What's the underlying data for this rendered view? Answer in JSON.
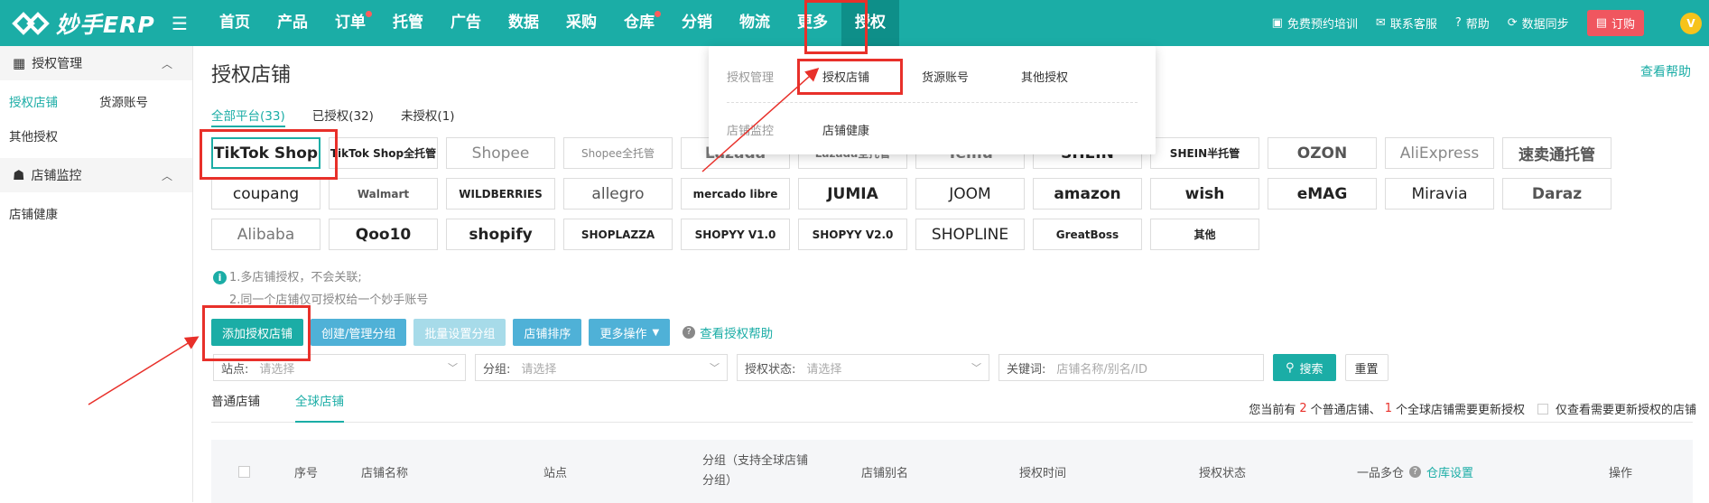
{
  "topbar": {
    "logo_text": "妙手ERP",
    "nav": [
      "首页",
      "产品",
      "订单",
      "托管",
      "广告",
      "数据",
      "采购",
      "仓库",
      "分销",
      "物流",
      "更多",
      "授权"
    ],
    "nav_dots": [
      "订单",
      "仓库"
    ],
    "active_nav": "授权",
    "tools": [
      "免费预约培训",
      "联系客服",
      "帮助",
      "数据同步"
    ],
    "order_label": "订购",
    "avatar_letter": "V"
  },
  "sidebar": {
    "groups": [
      {
        "label": "授权管理",
        "links": [
          "授权店铺",
          "货源账号",
          "其他授权"
        ]
      },
      {
        "label": "店铺监控",
        "links": [
          "店铺健康"
        ]
      }
    ]
  },
  "page": {
    "title": "授权店铺",
    "help_link": "查看帮助",
    "platform_tabs": [
      "全部平台(33)",
      "已授权(32)",
      "未授权(1)"
    ],
    "platforms": [
      "TikTok Shop",
      "TikTok Shop全托管",
      "Shopee",
      "Shopee全托管",
      "Lazada",
      "Lazada全托管",
      "Temu",
      "SHEIN",
      "SHEIN半托管",
      "OZON",
      "AliExpress",
      "速卖通托管",
      "coupang",
      "Walmart",
      "WILDBERRIES",
      "allegro",
      "mercado libre",
      "JUMIA",
      "JOOM",
      "amazon",
      "wish",
      "eMAG",
      "Miravia",
      "Daraz",
      "Alibaba",
      "Qoo10",
      "shopify",
      "SHOPLAZZA",
      "SHOPYY V1.0",
      "SHOPYY V2.0",
      "SHOPLINE",
      "GreatBoss",
      "其他"
    ],
    "notes": [
      "1.多店铺授权，不会关联;",
      "2.同一个店铺仅可授权给一个妙手账号"
    ],
    "buttons": [
      "添加授权店铺",
      "创建/管理分组",
      "批量设置分组",
      "店铺排序",
      "更多操作"
    ],
    "auth_help": "查看授权帮助",
    "filters": [
      {
        "label": "站点:",
        "placeholder": "请选择"
      },
      {
        "label": "分组:",
        "placeholder": "请选择"
      },
      {
        "label": "授权状态:",
        "placeholder": "请选择"
      },
      {
        "label": "关键词:",
        "placeholder": "店铺名称/别名/ID"
      }
    ],
    "search_label": "搜索",
    "reset_label": "重置",
    "store_tabs": [
      "普通店铺",
      "全球店铺"
    ],
    "notice": {
      "pre": "您当前有",
      "n1": "2",
      "mid": "个普通店铺、",
      "n2": "1",
      "post": "个全球店铺需要更新授权",
      "check_label": "仅查看需要更新授权的店铺"
    },
    "table_headers": [
      "序号",
      "店铺名称",
      "站点",
      "分组（支持全球店铺分组）",
      "店铺别名",
      "授权时间",
      "授权状态",
      "一品多仓",
      "仓库设置",
      "操作"
    ]
  },
  "dropdown": {
    "row1_label": "授权管理",
    "row1_items": [
      "授权店铺",
      "货源账号",
      "其他授权"
    ],
    "row2_label": "店铺监控",
    "row2_items": [
      "店铺健康"
    ]
  },
  "colors": {
    "brand": "#1bada6",
    "highlight": "#e8302a",
    "order": "#f0565f"
  }
}
